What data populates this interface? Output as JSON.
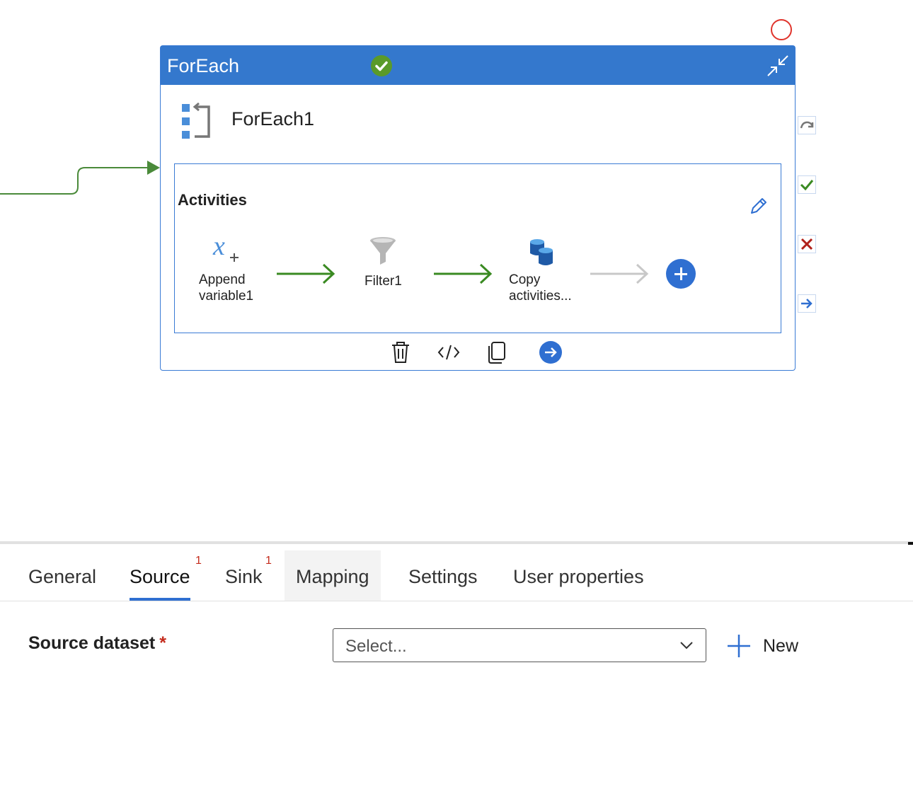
{
  "foreach": {
    "type_label": "ForEach",
    "name": "ForEach1",
    "status": "succeeded",
    "activities_title": "Activities",
    "activities": [
      {
        "icon": "variable-icon",
        "label_line1": "Append",
        "label_line2": "variable1"
      },
      {
        "icon": "filter-icon",
        "label_line1": "Filter1",
        "label_line2": ""
      },
      {
        "icon": "copy-data-icon",
        "label_line1": "Copy",
        "label_line2": "activities..."
      }
    ],
    "toolbar": [
      "delete-icon",
      "code-icon",
      "clone-icon",
      "go-to-icon"
    ],
    "side_outputs": [
      "skip-output",
      "success-output",
      "failure-output",
      "completion-output"
    ]
  },
  "tabs": {
    "items": [
      {
        "label": "General",
        "badge": ""
      },
      {
        "label": "Source",
        "badge": "1",
        "active": true
      },
      {
        "label": "Sink",
        "badge": "1"
      },
      {
        "label": "Mapping",
        "badge": ""
      },
      {
        "label": "Settings",
        "badge": ""
      },
      {
        "label": "User properties",
        "badge": ""
      }
    ]
  },
  "source": {
    "dataset_label": "Source dataset",
    "required_marker": "*",
    "select_placeholder": "Select...",
    "new_label": "New"
  },
  "colors": {
    "accent_blue": "#3478cd",
    "success_green": "#5a9a2a",
    "error_red": "#c42b1c",
    "arrow_green": "#3a8a22"
  }
}
